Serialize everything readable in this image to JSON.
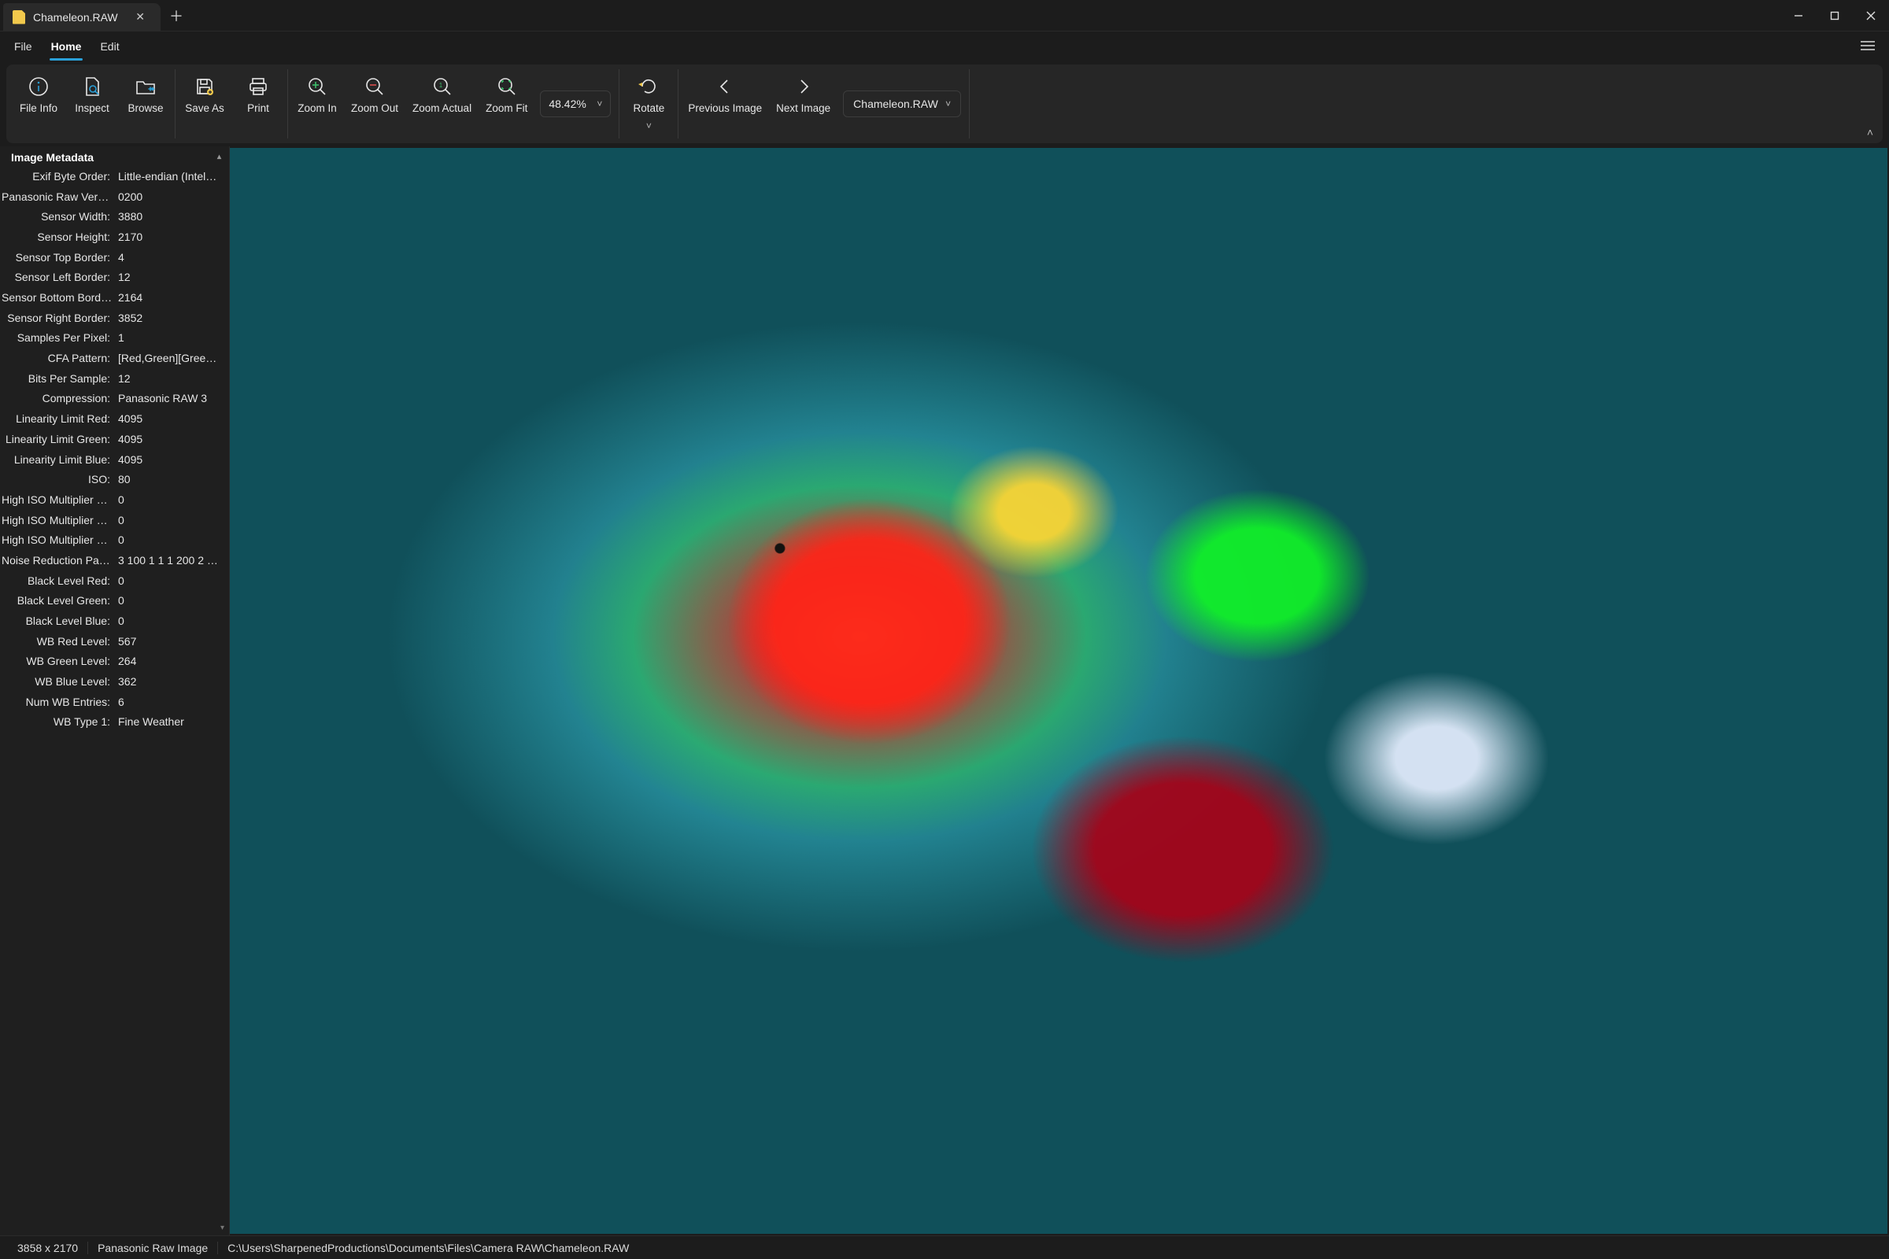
{
  "titlebar": {
    "tab_label": "Chameleon.RAW"
  },
  "menu": {
    "file": "File",
    "home": "Home",
    "edit": "Edit"
  },
  "ribbon": {
    "file_info": "File Info",
    "inspect": "Inspect",
    "browse": "Browse",
    "save_as": "Save As",
    "print": "Print",
    "zoom_in": "Zoom In",
    "zoom_out": "Zoom Out",
    "zoom_actual": "Zoom Actual",
    "zoom_fit": "Zoom Fit",
    "zoom_value": "48.42%",
    "rotate": "Rotate",
    "prev_image": "Previous Image",
    "next_image": "Next Image",
    "file_dropdown": "Chameleon.RAW"
  },
  "panel": {
    "title": "Image Metadata",
    "rows": [
      {
        "k": "Exif Byte Order",
        "v": "Little-endian (Intel…"
      },
      {
        "k": "Panasonic Raw Version",
        "v": "0200"
      },
      {
        "k": "Sensor Width",
        "v": "3880"
      },
      {
        "k": "Sensor Height",
        "v": "2170"
      },
      {
        "k": "Sensor Top Border",
        "v": "4"
      },
      {
        "k": "Sensor Left Border",
        "v": "12"
      },
      {
        "k": "Sensor Bottom Border",
        "v": "2164"
      },
      {
        "k": "Sensor Right Border",
        "v": "3852"
      },
      {
        "k": "Samples Per Pixel",
        "v": "1"
      },
      {
        "k": "CFA Pattern",
        "v": "[Red,Green][Green…"
      },
      {
        "k": "Bits Per Sample",
        "v": "12"
      },
      {
        "k": "Compression",
        "v": "Panasonic RAW 3"
      },
      {
        "k": "Linearity Limit Red",
        "v": "4095"
      },
      {
        "k": "Linearity Limit Green",
        "v": "4095"
      },
      {
        "k": "Linearity Limit Blue",
        "v": "4095"
      },
      {
        "k": "ISO",
        "v": "80"
      },
      {
        "k": "High ISO Multiplier Red",
        "v": "0"
      },
      {
        "k": "High ISO Multiplier Gr…",
        "v": "0"
      },
      {
        "k": "High ISO Multiplier Bl…",
        "v": "0"
      },
      {
        "k": "Noise Reduction Para…",
        "v": "3 100 1 1 1 200 2 …"
      },
      {
        "k": "Black Level Red",
        "v": "0"
      },
      {
        "k": "Black Level Green",
        "v": "0"
      },
      {
        "k": "Black Level Blue",
        "v": "0"
      },
      {
        "k": "WB Red Level",
        "v": "567"
      },
      {
        "k": "WB Green Level",
        "v": "264"
      },
      {
        "k": "WB Blue Level",
        "v": "362"
      },
      {
        "k": "Num WB Entries",
        "v": "6"
      },
      {
        "k": "WB Type 1",
        "v": "Fine Weather"
      }
    ]
  },
  "status": {
    "dimensions": "3858 x 2170",
    "format": "Panasonic Raw Image",
    "path": "C:\\Users\\SharpenedProductions\\Documents\\Files\\Camera RAW\\Chameleon.RAW"
  }
}
